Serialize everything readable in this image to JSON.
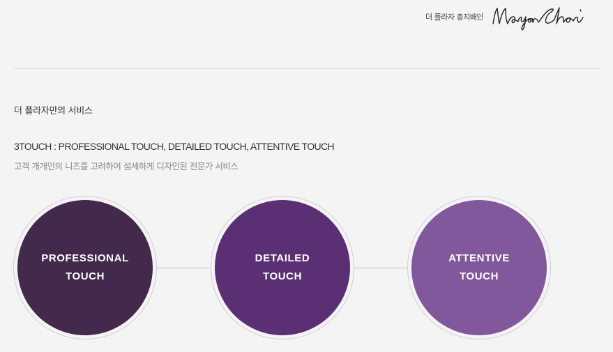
{
  "header": {
    "caption": "더 플라자 총지배인",
    "signature": "Namyoo Choi"
  },
  "section": {
    "title": "더 플라자만의 서비스",
    "headline": "3TOUCH : PROFESSIONAL TOUCH, DETAILED TOUCH, ATTENTIVE TOUCH",
    "subline": "고객 개개인의 니즈를 고려하여 섬세하게 디자인된 전문가 서비스"
  },
  "circles": [
    {
      "line1": "PROFESSIONAL",
      "line2": "TOUCH",
      "color": "#432a4d"
    },
    {
      "line1": "DETAILED",
      "line2": "TOUCH",
      "color": "#5b2f74"
    },
    {
      "line1": "ATTENTIVE",
      "line2": "TOUCH",
      "color": "#81589c"
    }
  ]
}
